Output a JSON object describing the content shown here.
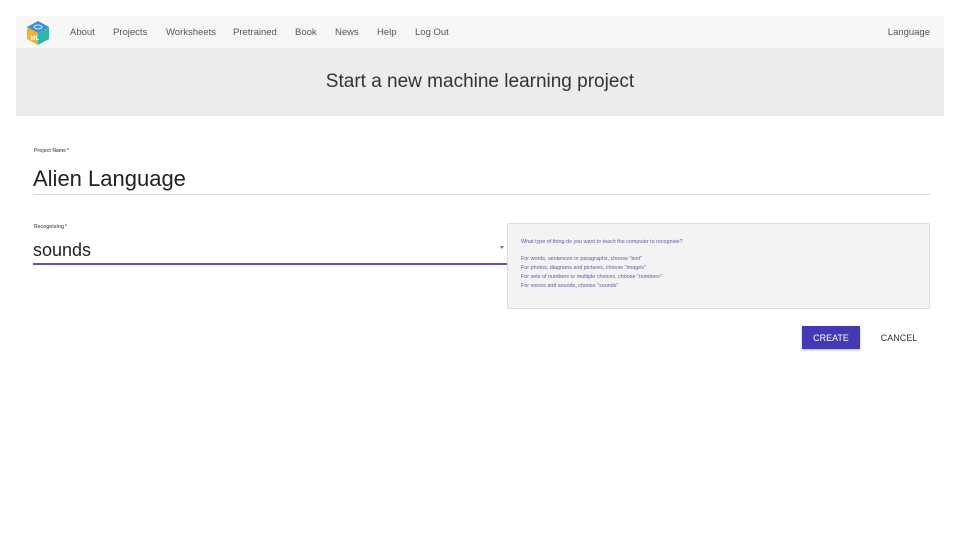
{
  "nav": {
    "items": [
      "About",
      "Projects",
      "Worksheets",
      "Pretrained",
      "Book",
      "News",
      "Help",
      "Log Out"
    ],
    "language": "Language",
    "logo_text": "ML"
  },
  "banner": {
    "title": "Start a new machine learning project"
  },
  "form": {
    "name_label": "Project Name",
    "name_value": "Alien Language",
    "type_label": "Recognising",
    "type_value": "sounds",
    "required_mark": "*"
  },
  "help": {
    "question": "What type of thing do you want to teach the computer to recognise?",
    "lines": [
      "For words, sentences or paragraphs, choose \"text\"",
      "For photos, diagrams and pictures, choose \"images\"",
      "For sets of numbers or multiple choices, choose \"numbers\"",
      "For voices and sounds, choose \"sounds\""
    ]
  },
  "actions": {
    "create": "CREATE",
    "cancel": "CANCEL"
  },
  "colors": {
    "accent": "#4339b5",
    "underline": "#5c56b8",
    "help_text": "#5a5aa8"
  }
}
